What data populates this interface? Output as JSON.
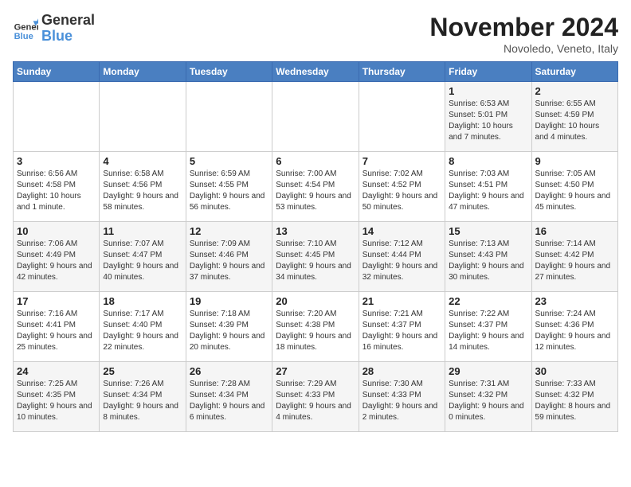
{
  "header": {
    "logo_line1": "General",
    "logo_line2": "Blue",
    "month": "November 2024",
    "location": "Novoledo, Veneto, Italy"
  },
  "weekdays": [
    "Sunday",
    "Monday",
    "Tuesday",
    "Wednesday",
    "Thursday",
    "Friday",
    "Saturday"
  ],
  "weeks": [
    [
      {
        "day": "",
        "info": ""
      },
      {
        "day": "",
        "info": ""
      },
      {
        "day": "",
        "info": ""
      },
      {
        "day": "",
        "info": ""
      },
      {
        "day": "",
        "info": ""
      },
      {
        "day": "1",
        "info": "Sunrise: 6:53 AM\nSunset: 5:01 PM\nDaylight: 10 hours and 7 minutes."
      },
      {
        "day": "2",
        "info": "Sunrise: 6:55 AM\nSunset: 4:59 PM\nDaylight: 10 hours and 4 minutes."
      }
    ],
    [
      {
        "day": "3",
        "info": "Sunrise: 6:56 AM\nSunset: 4:58 PM\nDaylight: 10 hours and 1 minute."
      },
      {
        "day": "4",
        "info": "Sunrise: 6:58 AM\nSunset: 4:56 PM\nDaylight: 9 hours and 58 minutes."
      },
      {
        "day": "5",
        "info": "Sunrise: 6:59 AM\nSunset: 4:55 PM\nDaylight: 9 hours and 56 minutes."
      },
      {
        "day": "6",
        "info": "Sunrise: 7:00 AM\nSunset: 4:54 PM\nDaylight: 9 hours and 53 minutes."
      },
      {
        "day": "7",
        "info": "Sunrise: 7:02 AM\nSunset: 4:52 PM\nDaylight: 9 hours and 50 minutes."
      },
      {
        "day": "8",
        "info": "Sunrise: 7:03 AM\nSunset: 4:51 PM\nDaylight: 9 hours and 47 minutes."
      },
      {
        "day": "9",
        "info": "Sunrise: 7:05 AM\nSunset: 4:50 PM\nDaylight: 9 hours and 45 minutes."
      }
    ],
    [
      {
        "day": "10",
        "info": "Sunrise: 7:06 AM\nSunset: 4:49 PM\nDaylight: 9 hours and 42 minutes."
      },
      {
        "day": "11",
        "info": "Sunrise: 7:07 AM\nSunset: 4:47 PM\nDaylight: 9 hours and 40 minutes."
      },
      {
        "day": "12",
        "info": "Sunrise: 7:09 AM\nSunset: 4:46 PM\nDaylight: 9 hours and 37 minutes."
      },
      {
        "day": "13",
        "info": "Sunrise: 7:10 AM\nSunset: 4:45 PM\nDaylight: 9 hours and 34 minutes."
      },
      {
        "day": "14",
        "info": "Sunrise: 7:12 AM\nSunset: 4:44 PM\nDaylight: 9 hours and 32 minutes."
      },
      {
        "day": "15",
        "info": "Sunrise: 7:13 AM\nSunset: 4:43 PM\nDaylight: 9 hours and 30 minutes."
      },
      {
        "day": "16",
        "info": "Sunrise: 7:14 AM\nSunset: 4:42 PM\nDaylight: 9 hours and 27 minutes."
      }
    ],
    [
      {
        "day": "17",
        "info": "Sunrise: 7:16 AM\nSunset: 4:41 PM\nDaylight: 9 hours and 25 minutes."
      },
      {
        "day": "18",
        "info": "Sunrise: 7:17 AM\nSunset: 4:40 PM\nDaylight: 9 hours and 22 minutes."
      },
      {
        "day": "19",
        "info": "Sunrise: 7:18 AM\nSunset: 4:39 PM\nDaylight: 9 hours and 20 minutes."
      },
      {
        "day": "20",
        "info": "Sunrise: 7:20 AM\nSunset: 4:38 PM\nDaylight: 9 hours and 18 minutes."
      },
      {
        "day": "21",
        "info": "Sunrise: 7:21 AM\nSunset: 4:37 PM\nDaylight: 9 hours and 16 minutes."
      },
      {
        "day": "22",
        "info": "Sunrise: 7:22 AM\nSunset: 4:37 PM\nDaylight: 9 hours and 14 minutes."
      },
      {
        "day": "23",
        "info": "Sunrise: 7:24 AM\nSunset: 4:36 PM\nDaylight: 9 hours and 12 minutes."
      }
    ],
    [
      {
        "day": "24",
        "info": "Sunrise: 7:25 AM\nSunset: 4:35 PM\nDaylight: 9 hours and 10 minutes."
      },
      {
        "day": "25",
        "info": "Sunrise: 7:26 AM\nSunset: 4:34 PM\nDaylight: 9 hours and 8 minutes."
      },
      {
        "day": "26",
        "info": "Sunrise: 7:28 AM\nSunset: 4:34 PM\nDaylight: 9 hours and 6 minutes."
      },
      {
        "day": "27",
        "info": "Sunrise: 7:29 AM\nSunset: 4:33 PM\nDaylight: 9 hours and 4 minutes."
      },
      {
        "day": "28",
        "info": "Sunrise: 7:30 AM\nSunset: 4:33 PM\nDaylight: 9 hours and 2 minutes."
      },
      {
        "day": "29",
        "info": "Sunrise: 7:31 AM\nSunset: 4:32 PM\nDaylight: 9 hours and 0 minutes."
      },
      {
        "day": "30",
        "info": "Sunrise: 7:33 AM\nSunset: 4:32 PM\nDaylight: 8 hours and 59 minutes."
      }
    ]
  ]
}
